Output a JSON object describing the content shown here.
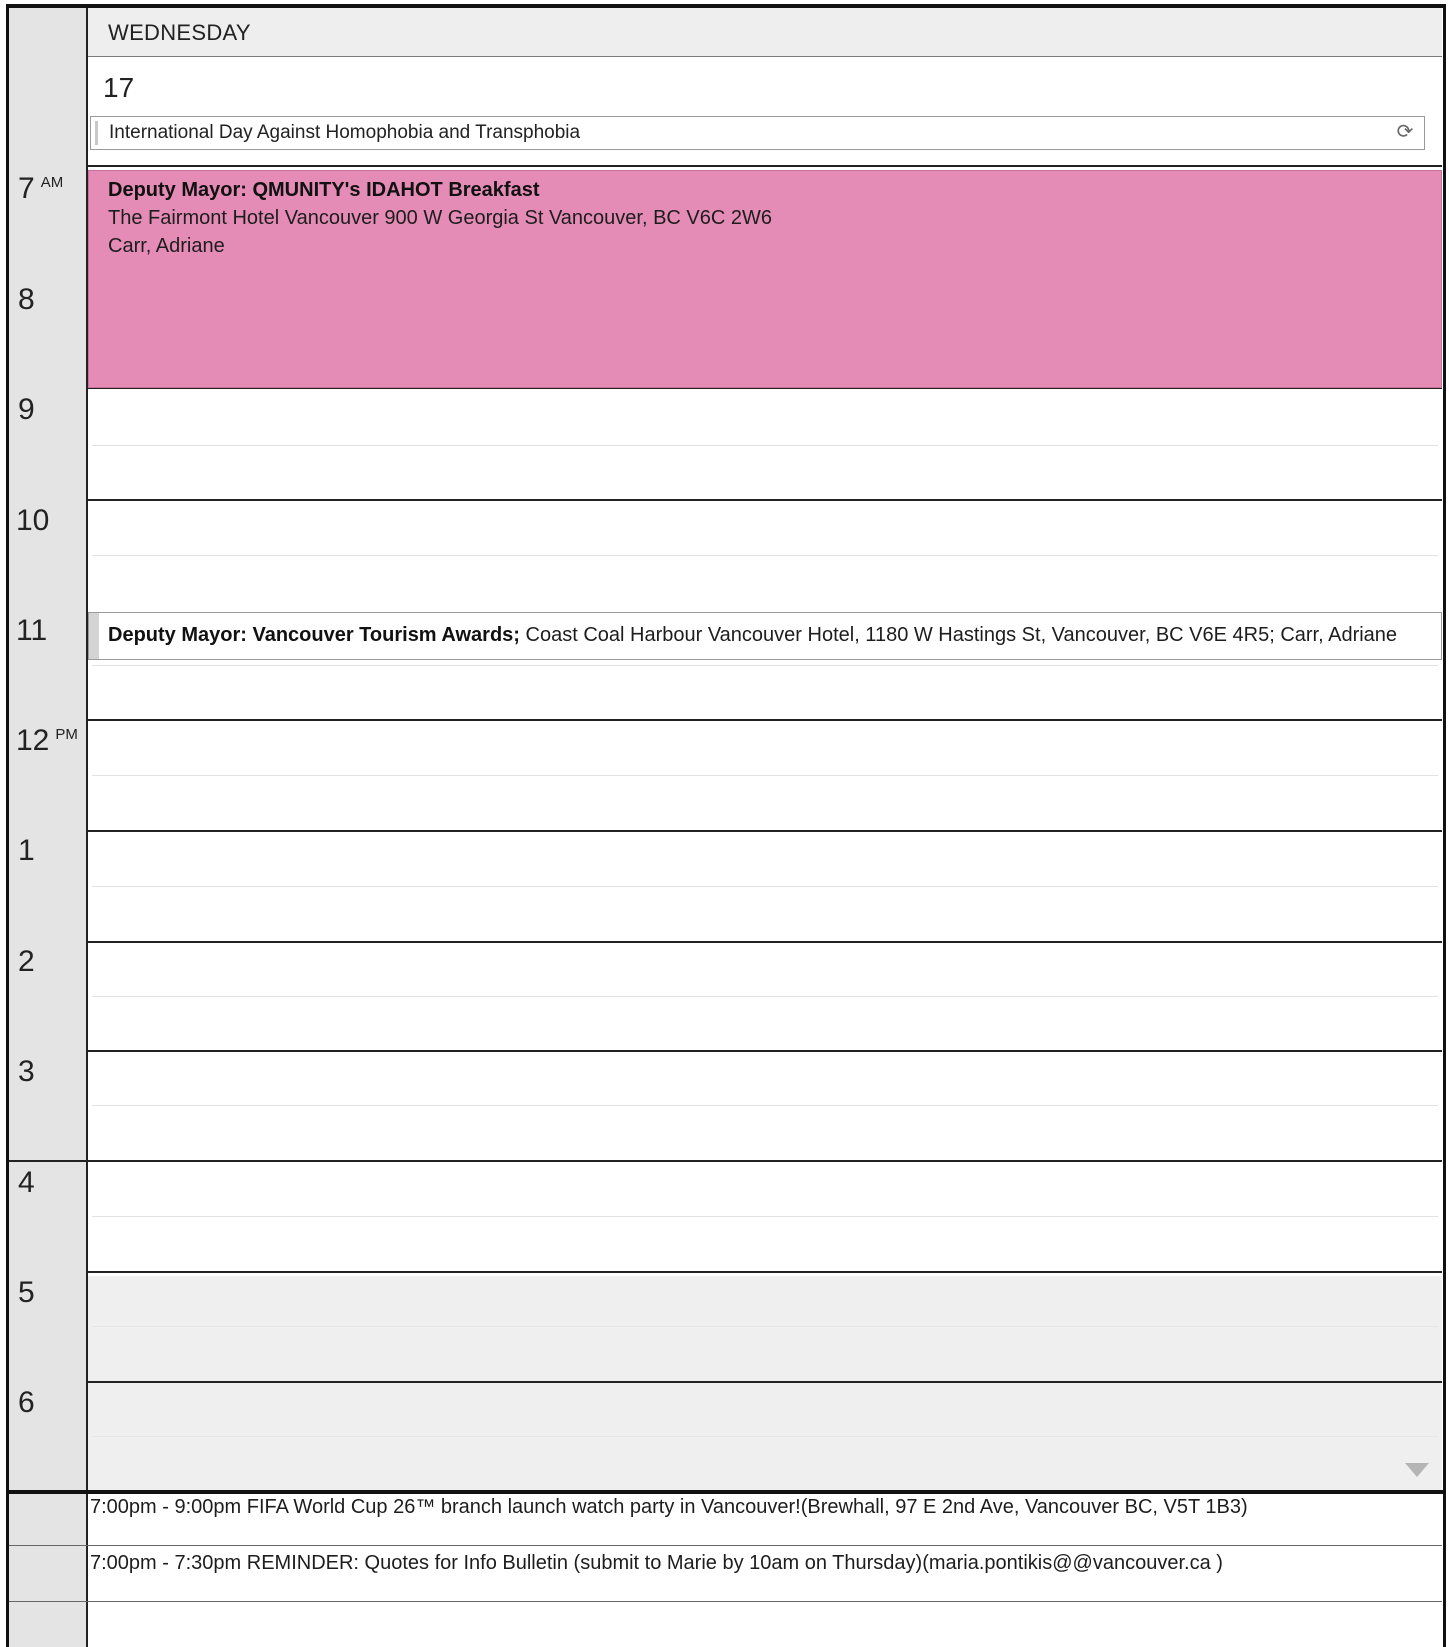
{
  "header": {
    "day_name": "WEDNESDAY",
    "day_number": "17",
    "all_day_event": "International Day Against Homophobia and Transphobia"
  },
  "hours": [
    {
      "label": "7",
      "suffix": "AM"
    },
    {
      "label": "8",
      "suffix": ""
    },
    {
      "label": "9",
      "suffix": ""
    },
    {
      "label": "10",
      "suffix": ""
    },
    {
      "label": "11",
      "suffix": ""
    },
    {
      "label": "12",
      "suffix": "PM"
    },
    {
      "label": "1",
      "suffix": ""
    },
    {
      "label": "2",
      "suffix": ""
    },
    {
      "label": "3",
      "suffix": ""
    },
    {
      "label": "4",
      "suffix": ""
    },
    {
      "label": "5",
      "suffix": ""
    },
    {
      "label": "6",
      "suffix": ""
    }
  ],
  "appointments": {
    "breakfast": {
      "title": "Deputy Mayor: QMUNITY's IDAHOT Breakfast",
      "location": "The Fairmont Hotel Vancouver 900 W Georgia St Vancouver, BC V6C 2W6",
      "organizer": "Carr, Adriane",
      "color": "#e48bb6"
    },
    "awards": {
      "title": "Deputy Mayor: Vancouver Tourism Awards;",
      "details": " Coast Coal Harbour Vancouver Hotel, 1180 W Hastings St, Vancouver, BC V6E 4R5; Carr, Adriane"
    }
  },
  "tasks": [
    "7:00pm - 9:00pm FIFA World Cup 26™ branch launch watch party in Vancouver!(Brewhall, 97 E 2nd Ave, Vancouver BC, V5T 1B3)",
    "7:00pm - 7:30pm REMINDER: Quotes for Info Bulletin (submit to Marie by 10am on Thursday)(maria.pontikis@@vancouver.ca )"
  ],
  "icons": {
    "recurrence": "recurrence-icon",
    "scroll_down": "scroll-down-arrow-icon"
  }
}
